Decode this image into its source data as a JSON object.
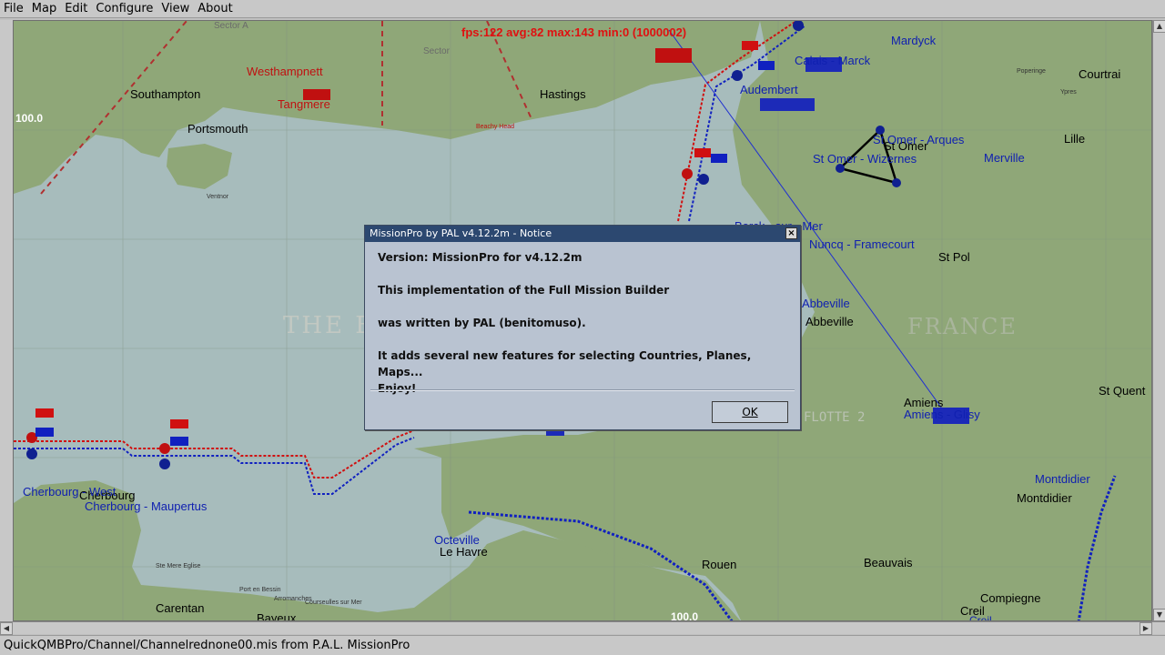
{
  "menu": [
    "File",
    "Map",
    "Edit",
    "Configure",
    "View",
    "About"
  ],
  "fps": "fps:122 avg:82 max:143 min:0 (1000002)",
  "map": {
    "grid_readouts": [
      "100.0",
      "100.0"
    ],
    "sea_label": "THE EN",
    "country_label": "FRANCE",
    "fleet_label": "FLOTTE 2",
    "sector_labels": [
      "Sector A",
      "Sector"
    ],
    "towns_black": [
      {
        "id": "southampton",
        "text": "Southampton"
      },
      {
        "id": "portsmouth",
        "text": "Portsmouth"
      },
      {
        "id": "hastings",
        "text": "Hastings"
      },
      {
        "id": "courtrai",
        "text": "Courtrai"
      },
      {
        "id": "lille",
        "text": "Lille"
      },
      {
        "id": "st-omer",
        "text": "St Omer"
      },
      {
        "id": "st-pol",
        "text": "St Pol"
      },
      {
        "id": "abbeville",
        "text": "Abbeville"
      },
      {
        "id": "amiens",
        "text": "Amiens"
      },
      {
        "id": "st-quent",
        "text": "St Quent"
      },
      {
        "id": "montdidier",
        "text": "Montdidier"
      },
      {
        "id": "beauvais",
        "text": "Beauvais"
      },
      {
        "id": "rouen",
        "text": "Rouen"
      },
      {
        "id": "le-havre",
        "text": "Le Havre"
      },
      {
        "id": "cherbourg",
        "text": "Cherbourg"
      },
      {
        "id": "carentan",
        "text": "Carentan"
      },
      {
        "id": "bayeux",
        "text": "Bayeux"
      },
      {
        "id": "compiegne",
        "text": "Compiegne"
      },
      {
        "id": "creil",
        "text": "Creil"
      }
    ],
    "airfields_red": [
      {
        "id": "westhampnett",
        "text": "Westhampnett"
      },
      {
        "id": "tangmere",
        "text": "Tangmere"
      }
    ],
    "airfields_blue": [
      {
        "id": "mardyck",
        "text": "Mardyck"
      },
      {
        "id": "calais-marck",
        "text": "Calais - Marck"
      },
      {
        "id": "audembert",
        "text": "Audembert"
      },
      {
        "id": "st-omer-arques",
        "text": "St Omer - Arques"
      },
      {
        "id": "st-omer-wizernes",
        "text": "St Omer - Wizernes"
      },
      {
        "id": "merville",
        "text": "Merville"
      },
      {
        "id": "berck",
        "text": "Berck - sur - Mer"
      },
      {
        "id": "nuncq",
        "text": "Nuncq - Framecourt"
      },
      {
        "id": "abbeville-drucat",
        "text": "Abbeville"
      },
      {
        "id": "amiens-glisy",
        "text": "Amiens - Glisy"
      },
      {
        "id": "montdidier-af",
        "text": "Montdidier"
      },
      {
        "id": "octeville",
        "text": "Octeville"
      },
      {
        "id": "cherbourg-west",
        "text": "Cherbourg - West"
      },
      {
        "id": "cherbourg-maupertus",
        "text": "Cherbourg - Maupertus"
      },
      {
        "id": "creil-af",
        "text": "Creil"
      }
    ],
    "small_places": [
      "Ventnor",
      "Beachy Head",
      "Poperinge",
      "Ypres",
      "Ste Mere Eglise",
      "Port en Bessin",
      "Arromanches",
      "Courseulles sur Mer"
    ]
  },
  "dialog": {
    "title": "MissionPro by PAL v4.12.2m - Notice",
    "close_glyph": "×",
    "line1": "Version: MissionPro for v4.12.2m",
    "line2": "This implementation of the Full Mission Builder",
    "line3": "was written by PAL (benitomuso).",
    "line4": "It adds several new features for selecting Countries, Planes, Maps...",
    "line5": "Enjoy!",
    "ok_label": "OK"
  },
  "status_text": "QuickQMBPro/Channel/Channelrednone00.mis from P.A.L. MissionPro",
  "colors": {
    "land": "#8fa778",
    "sea": "#a7bcbc",
    "red": "#d01010",
    "blue": "#1020c0",
    "dialog_title": "#2c4870"
  }
}
